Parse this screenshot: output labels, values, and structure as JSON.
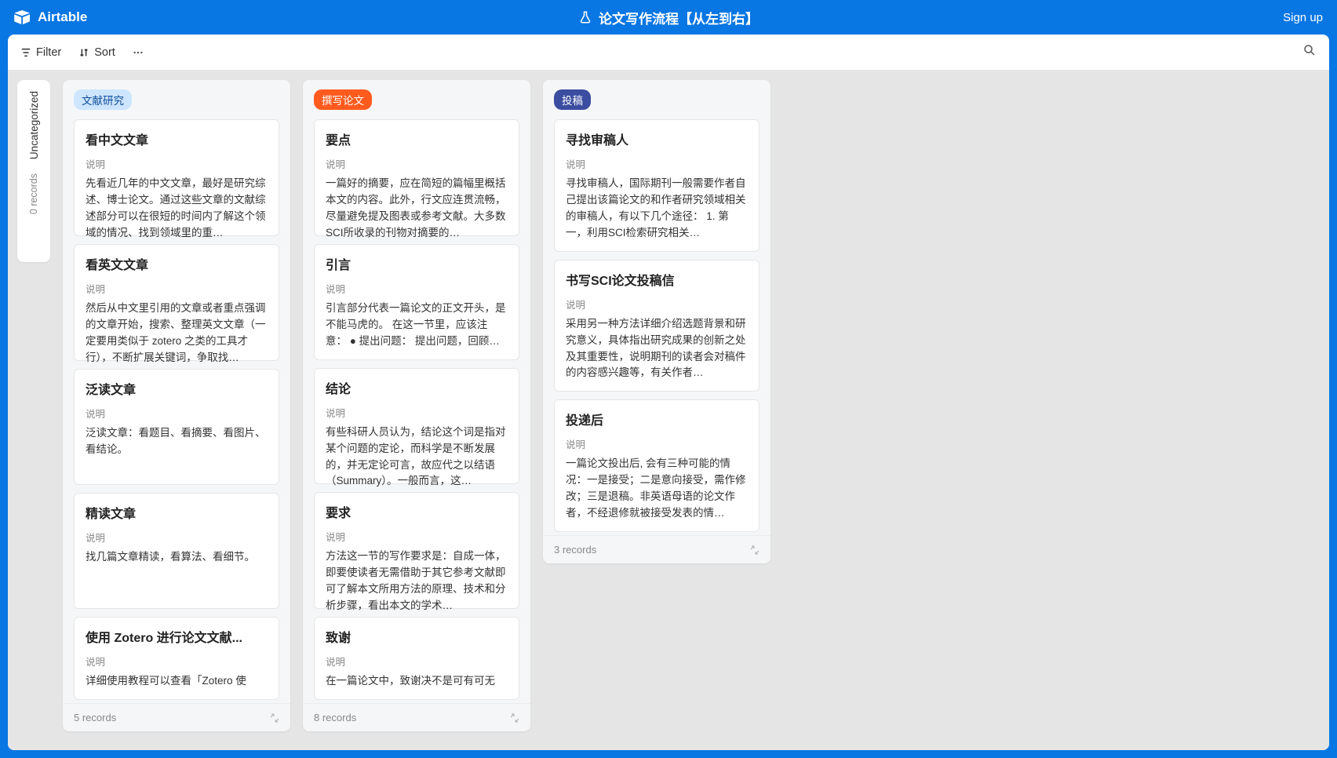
{
  "header": {
    "brand": "Airtable",
    "title": "论文写作流程【从左到右】",
    "signup": "Sign up"
  },
  "toolbar": {
    "filter": "Filter",
    "sort": "Sort"
  },
  "uncategorized": {
    "label": "Uncategorized",
    "count": "0 records"
  },
  "stacks": [
    {
      "id": "research",
      "pill": "文献研究",
      "pillClass": "pill-blue",
      "footer": "5 records",
      "cards": [
        {
          "title": "看中文文章",
          "label": "说明",
          "body": "先看近几年的中文文章，最好是研究综述、博士论文。通过这些文章的文献综述部分可以在很短的时间内了解这个领域的情况、找到领域里的重…"
        },
        {
          "title": "看英文文章",
          "label": "说明",
          "body": "然后从中文里引用的文章或者重点强调的文章开始，搜索、整理英文文章（一定要用类似于 zotero 之类的工具才行），不断扩展关键词，争取找…"
        },
        {
          "title": "泛读文章",
          "label": "说明",
          "body": "泛读文章：看题目、看摘要、看图片、看结论。"
        },
        {
          "title": "精读文章",
          "label": "说明",
          "body": "找几篇文章精读，看算法、看细节。"
        },
        {
          "title": "使用 Zotero 进行论文文献...",
          "label": "说明",
          "body": "详细使用教程可以查看「Zotero 使",
          "cut": true
        }
      ]
    },
    {
      "id": "writing",
      "pill": "撰写论文",
      "pillClass": "pill-orange",
      "footer": "8 records",
      "cards": [
        {
          "title": "要点",
          "label": "说明",
          "body": "一篇好的摘要，应在简短的篇幅里概括本文的内容。此外，行文应连贯流畅，尽量避免提及图表或参考文献。大多数SCI所收录的刊物对摘要的…"
        },
        {
          "title": "引言",
          "label": "说明",
          "body": "引言部分代表一篇论文的正文开头，是不能马虎的。\n在这一节里，应该注意：\n● 提出问题： 提出问题，回顾…"
        },
        {
          "title": "结论",
          "label": "说明",
          "body": "有些科研人员认为，结论这个词是指对某个问题的定论，而科学是不断发展的，并无定论可言，故应代之以结语（Summary）。一般而言，这…"
        },
        {
          "title": "要求",
          "label": "说明",
          "body": "方法这一节的写作要求是：自成一体，即要使读者无需借助于其它参考文献即可了解本文所用方法的原理、技术和分析步骤，看出本文的学术…"
        },
        {
          "title": "致谢",
          "label": "说明",
          "body": "在一篇论文中，致谢决不是可有可无",
          "cut": true
        }
      ]
    },
    {
      "id": "submit",
      "pill": "投稿",
      "pillClass": "pill-navy",
      "footer": "3 records",
      "cards": [
        {
          "title": "寻找审稿人",
          "label": "说明",
          "body": "寻找审稿人，国际期刊一般需要作者自己提出该篇论文的和作者研究领域相关的审稿人，有以下几个途径：\n1. 第一，利用SCI检索研究相关…"
        },
        {
          "title": "书写SCI论文投稿信",
          "label": "说明",
          "body": "采用另一种方法详细介绍选题背景和研究意义，具体指出研究成果的创新之处及其重要性，说明期刊的读者会对稿件的内容感兴趣等，有关作者…"
        },
        {
          "title": "投递后",
          "label": "说明",
          "body": "一篇论文投出后, 会有三种可能的情况：一是接受；二是意向接受，需作修改；三是退稿。非英语母语的论文作者，不经退修就被接受发表的情…"
        }
      ]
    }
  ]
}
